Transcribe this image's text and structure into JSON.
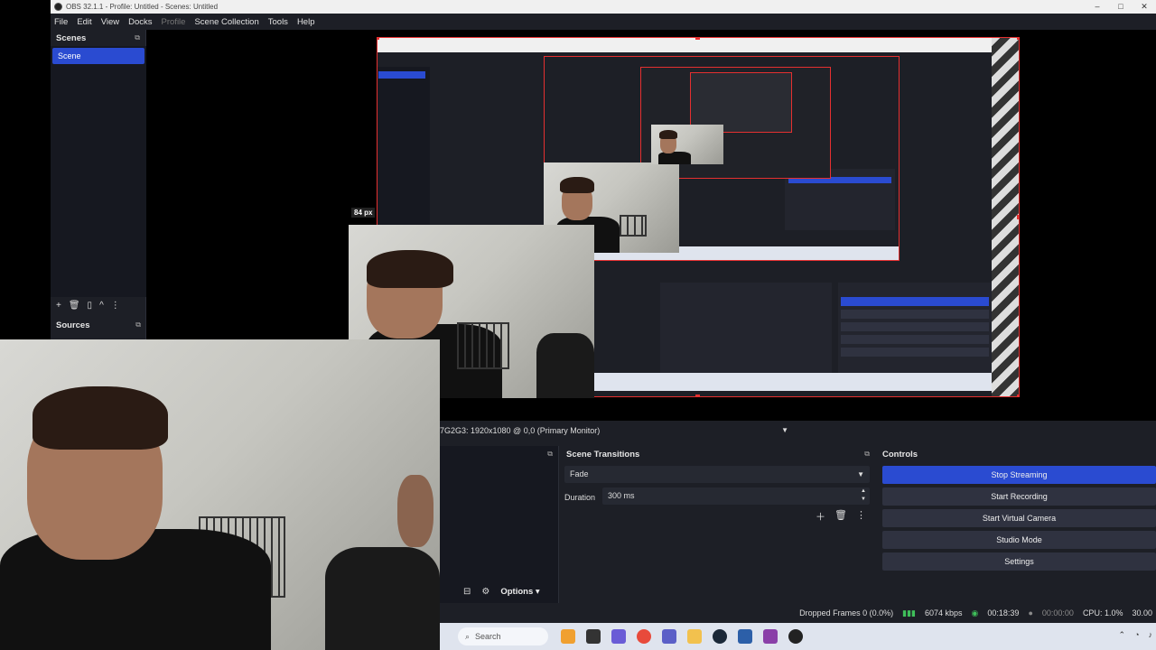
{
  "window": {
    "title": "OBS 32.1.1 - Profile: Untitled - Scenes: Untitled",
    "controls": [
      "–",
      "□",
      "✕"
    ]
  },
  "menu": {
    "file": "File",
    "edit": "Edit",
    "view": "View",
    "docks": "Docks",
    "profile": "Profile",
    "scene_collection": "Scene Collection",
    "tools": "Tools",
    "help": "Help"
  },
  "scenes": {
    "title": "Scenes",
    "items": [
      "Scene"
    ],
    "toolbar": [
      "+",
      "🗑",
      "▯",
      "^",
      "⋮"
    ]
  },
  "sources": {
    "title": "Sources"
  },
  "preview": {
    "size_label": "84 px"
  },
  "monitor": {
    "label": "7G2G3: 1920x1080 @ 0,0 (Primary Monitor)"
  },
  "source_toolbar": {
    "options_label": "Options ▾"
  },
  "transitions": {
    "title": "Scene Transitions",
    "selected": "Fade",
    "duration_label": "Duration",
    "duration_value": "300 ms"
  },
  "controls": {
    "title": "Controls",
    "buttons": [
      "Stop Streaming",
      "Start Recording",
      "Start Virtual Camera",
      "Studio Mode",
      "Settings"
    ]
  },
  "status": {
    "dropped_frames": "Dropped Frames 0 (0.0%)",
    "bitrate": "6074 kbps",
    "stream_time": "00:18:39",
    "record_time": "00:00:00",
    "cpu": "CPU: 1.0%",
    "fps": "30.00"
  },
  "taskbar": {
    "search_placeholder": "Search"
  },
  "colors": {
    "accent": "#2a4bd1",
    "dock_bg": "#1d1f26",
    "selection_border": "#e53030",
    "signal": "#3fc05a"
  }
}
